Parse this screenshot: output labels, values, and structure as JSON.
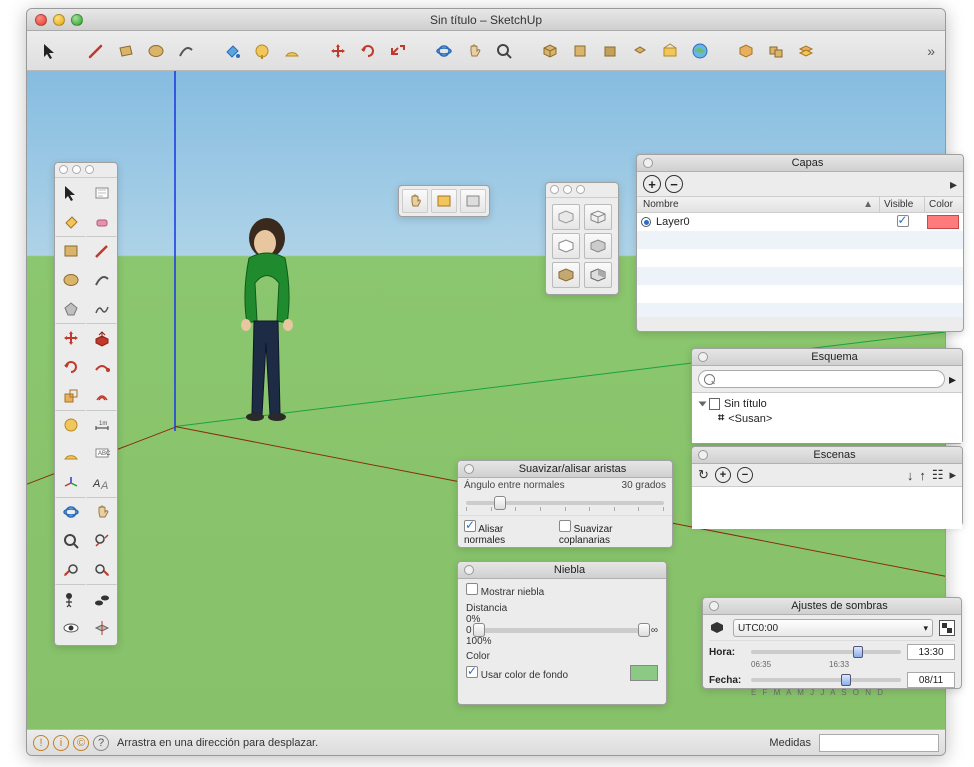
{
  "window": {
    "title": "Sin título – SketchUp"
  },
  "statusbar": {
    "hint": "Arrastra en una dirección para desplazar.",
    "measure_label": "Medidas"
  },
  "panels": {
    "layers": {
      "title": "Capas",
      "columns": {
        "name": "Nombre",
        "visible": "Visible",
        "color": "Color"
      },
      "rows": [
        {
          "name": "Layer0",
          "visible": true,
          "color": "#ff7a7a",
          "active": true
        }
      ]
    },
    "outline": {
      "title": "Esquema",
      "search_placeholder": "",
      "tree": {
        "root": "Sin título",
        "child": "<Susan>"
      }
    },
    "scenes": {
      "title": "Escenas"
    },
    "soften": {
      "title": "Suavizar/alisar aristas",
      "angle_label": "Ángulo entre normales",
      "angle_value": "30",
      "angle_unit": "grados",
      "smooth_normals": "Alisar normales",
      "soften_coplanar": "Suavizar coplanarias"
    },
    "fog": {
      "title": "Niebla",
      "show": "Mostrar niebla",
      "distance": "Distancia",
      "pct0": "0%",
      "zero": "0",
      "inf": "∞",
      "pct100": "100%",
      "color_label": "Color",
      "use_bg": "Usar color de fondo"
    },
    "shadows": {
      "title": "Ajustes de sombras",
      "tz": "UTC0:00",
      "time_label": "Hora:",
      "time_min": "06:35",
      "time_max": "16:33",
      "time_value": "13:30",
      "date_label": "Fecha:",
      "date_scale": "E F M A M J J A S O N D",
      "date_value": "08/11"
    }
  }
}
